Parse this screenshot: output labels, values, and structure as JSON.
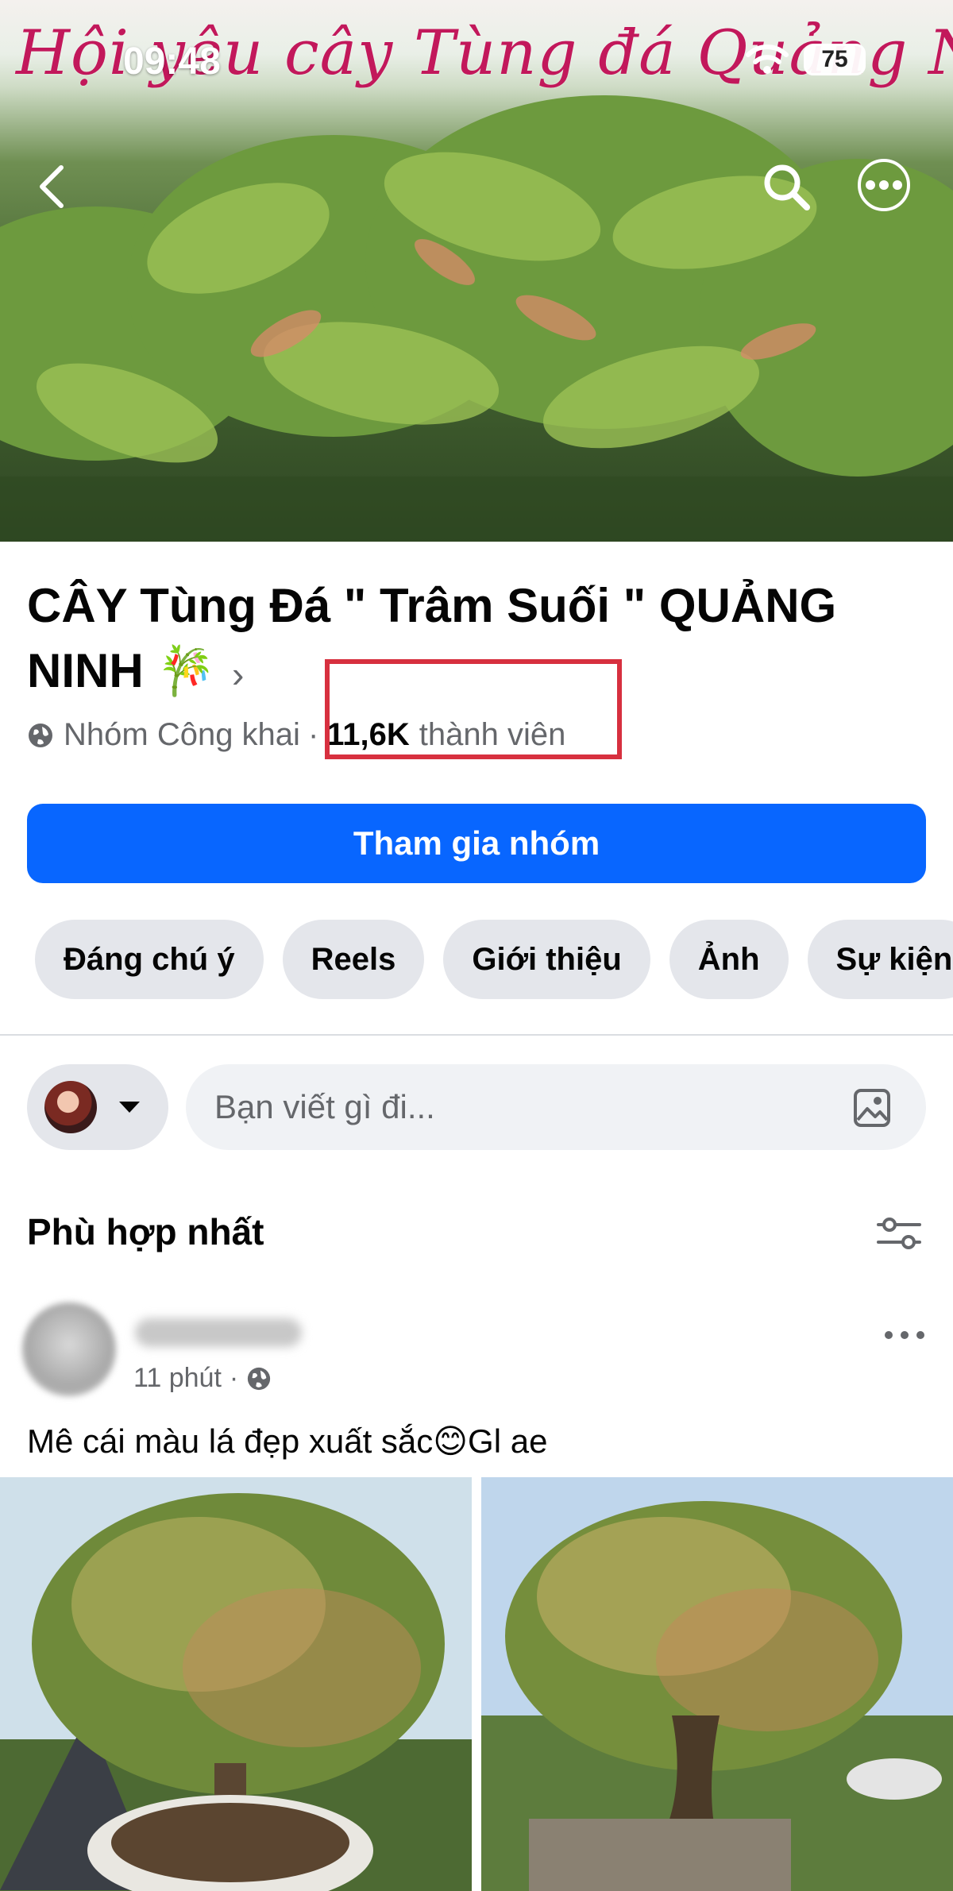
{
  "status_bar": {
    "time": "09:48",
    "battery": "75"
  },
  "cover": {
    "banner_text": "Hội yêu cây Tùng đá Quảng Ninh"
  },
  "group": {
    "name": "CÂY Tùng Đá \" Trâm Suối \" QUẢNG NINH 🎋",
    "privacy": "Nhóm Công khai",
    "separator": "·",
    "member_count": "11,6K",
    "member_label": "thành viên"
  },
  "join_button": "Tham gia nhóm",
  "tabs": [
    "Đáng chú ý",
    "Reels",
    "Giới thiệu",
    "Ảnh",
    "Sự kiện"
  ],
  "composer": {
    "placeholder": "Bạn viết gì đi..."
  },
  "feed": {
    "sort_label": "Phù hợp nhất"
  },
  "post": {
    "time": "11 phút",
    "separator": "·",
    "text": "Mê cái màu lá đẹp xuất sắc😊Gl ae"
  },
  "colors": {
    "primary": "#0866ff",
    "highlight_box": "#d7303f",
    "tab_bg": "#e4e6eb"
  },
  "icons": [
    "back-icon",
    "search-icon",
    "more-icon",
    "globe-icon",
    "caret-down-icon",
    "photo-icon",
    "filter-icon",
    "more-horizontal-icon",
    "wifi-icon",
    "battery-icon"
  ]
}
